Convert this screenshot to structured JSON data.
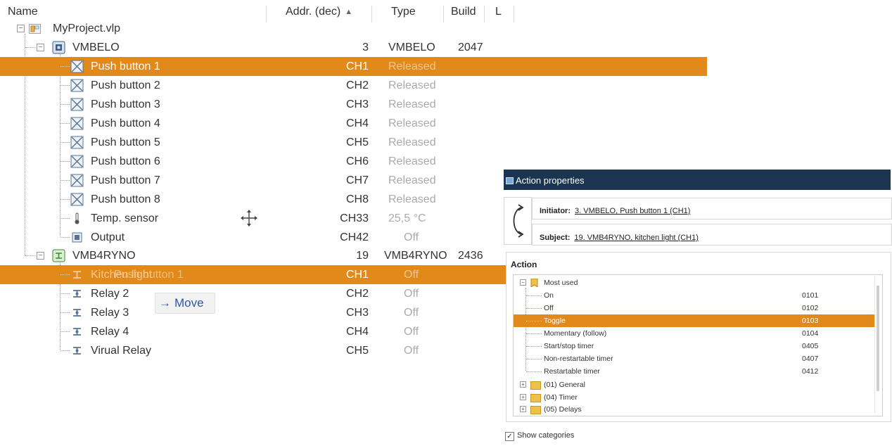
{
  "columns": {
    "name": "Name",
    "addr": "Addr. (dec)",
    "type": "Type",
    "build": "Build",
    "l": "L"
  },
  "tree": {
    "project": {
      "name": "MyProject.vlp"
    },
    "modules": [
      {
        "name": "VMBELO",
        "addr": "3",
        "type": "VMBELO",
        "build": "2047",
        "channels": [
          {
            "name": "Push button 1",
            "addr": "CH1",
            "type": "Released",
            "icon": "push-button-icon",
            "selected": true
          },
          {
            "name": "Push button 2",
            "addr": "CH2",
            "type": "Released",
            "icon": "push-button-icon"
          },
          {
            "name": "Push button 3",
            "addr": "CH3",
            "type": "Released",
            "icon": "push-button-icon"
          },
          {
            "name": "Push button 4",
            "addr": "CH4",
            "type": "Released",
            "icon": "push-button-icon"
          },
          {
            "name": "Push button 5",
            "addr": "CH5",
            "type": "Released",
            "icon": "push-button-icon"
          },
          {
            "name": "Push button 6",
            "addr": "CH6",
            "type": "Released",
            "icon": "push-button-icon"
          },
          {
            "name": "Push button 7",
            "addr": "CH7",
            "type": "Released",
            "icon": "push-button-icon"
          },
          {
            "name": "Push button 8",
            "addr": "CH8",
            "type": "Released",
            "icon": "push-button-icon"
          },
          {
            "name": "Temp. sensor",
            "addr": "CH33",
            "type": "25,5 °C",
            "icon": "thermometer-icon"
          },
          {
            "name": "Output",
            "addr": "CH42",
            "type": "Off",
            "icon": "output-icon"
          }
        ]
      },
      {
        "name": "VMB4RYNO",
        "addr": "19",
        "type": "VMB4RYNO",
        "build": "2436",
        "channels": [
          {
            "name": "Kitchen light",
            "addr": "CH1",
            "type": "Off",
            "icon": "relay-icon",
            "selected": true
          },
          {
            "name": "Relay 2",
            "addr": "CH2",
            "type": "Off",
            "icon": "relay-icon"
          },
          {
            "name": "Relay 3",
            "addr": "CH3",
            "type": "Off",
            "icon": "relay-icon"
          },
          {
            "name": "Relay 4",
            "addr": "CH4",
            "type": "Off",
            "icon": "relay-icon"
          },
          {
            "name": "Virual Relay",
            "addr": "CH5",
            "type": "Off",
            "icon": "relay-icon"
          }
        ]
      }
    ]
  },
  "drag": {
    "ghost_label": "Push button 1",
    "tooltip": "Move",
    "cursor_icon": "move-cursor-icon"
  },
  "action_properties": {
    "title": "Action properties",
    "initiator_label": "Initiator:",
    "initiator_value": "3. VMBELO, Push button 1 (CH1)",
    "subject_label": "Subject:",
    "subject_value": "19. VMB4RYNO, kitchen light (CH1)",
    "action_header": "Action",
    "category_open": "Most used",
    "actions": [
      {
        "label": "On",
        "code": "0101"
      },
      {
        "label": "Off",
        "code": "0102"
      },
      {
        "label": "Toggle",
        "code": "0103",
        "selected": true
      },
      {
        "label": "Momentary (follow)",
        "code": "0104"
      },
      {
        "label": "Start/stop timer",
        "code": "0405"
      },
      {
        "label": "Non-restartable timer",
        "code": "0407"
      },
      {
        "label": "Restartable timer",
        "code": "0412"
      }
    ],
    "categories": [
      {
        "label": "(01) General"
      },
      {
        "label": "(04) Timer"
      },
      {
        "label": "(05) Delays"
      }
    ],
    "show_categories_label": "Show categories",
    "show_categories_checked": true
  },
  "colors": {
    "selection": "#e2891c",
    "title_bar": "#1b3550"
  }
}
